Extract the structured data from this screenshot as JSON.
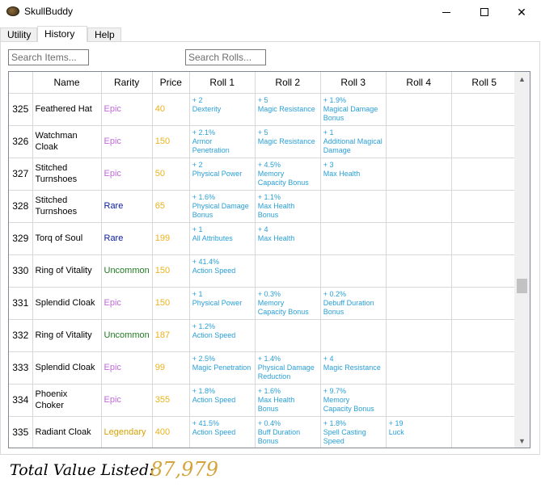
{
  "window": {
    "title": "SkullBuddy",
    "controls": {
      "minimize": "minimize",
      "maximize": "maximize",
      "close": "✕"
    }
  },
  "tabs": [
    {
      "label": "Utility",
      "active": false
    },
    {
      "label": "History",
      "active": true
    },
    {
      "label": "Help",
      "active": false
    }
  ],
  "search": {
    "items_placeholder": "Search Items...",
    "rolls_placeholder": "Search Rolls..."
  },
  "table": {
    "columns": [
      "",
      "Name",
      "Rarity",
      "Price",
      "Roll 1",
      "Roll 2",
      "Roll 3",
      "Roll 4",
      "Roll 5"
    ],
    "rows": [
      {
        "num": "325",
        "name": "Feathered Hat",
        "rarity": "Epic",
        "price": "40",
        "rolls": [
          "+ 2\nDexterity",
          "+ 5\nMagic Resistance",
          "+ 1.9%\nMagical Damage\nBonus",
          "",
          ""
        ]
      },
      {
        "num": "326",
        "name": "Watchman\nCloak",
        "rarity": "Epic",
        "price": "150",
        "rolls": [
          "+ 2.1%\nArmor\nPenetration",
          "+ 5\nMagic Resistance",
          "+ 1\nAdditional Magical\nDamage",
          "",
          ""
        ]
      },
      {
        "num": "327",
        "name": "Stitched\nTurnshoes",
        "rarity": "Epic",
        "price": "50",
        "rolls": [
          "+ 2\nPhysical Power",
          "+ 4.5%\nMemory\nCapacity Bonus",
          "+ 3\nMax Health",
          "",
          ""
        ]
      },
      {
        "num": "328",
        "name": "Stitched\nTurnshoes",
        "rarity": "Rare",
        "price": "65",
        "rolls": [
          "+ 1.6%\nPhysical Damage\nBonus",
          "+ 1.1%\nMax Health\nBonus",
          "",
          "",
          ""
        ]
      },
      {
        "num": "329",
        "name": "Torq of Soul",
        "rarity": "Rare",
        "price": "199",
        "rolls": [
          "+ 1\nAll Attributes",
          "+ 4\nMax Health",
          "",
          "",
          ""
        ]
      },
      {
        "num": "330",
        "name": "Ring of Vitality",
        "rarity": "Uncommon",
        "price": "150",
        "rolls": [
          "+ 41.4%\nAction Speed",
          "",
          "",
          "",
          ""
        ]
      },
      {
        "num": "331",
        "name": "Splendid Cloak",
        "rarity": "Epic",
        "price": "150",
        "rolls": [
          "+ 1\nPhysical Power",
          "+ 0.3%\nMemory\nCapacity Bonus",
          "+ 0.2%\nDebuff Duration\nBonus",
          "",
          ""
        ]
      },
      {
        "num": "332",
        "name": "Ring of Vitality",
        "rarity": "Uncommon",
        "price": "187",
        "rolls": [
          "+ 1.2%\nAction Speed",
          "",
          "",
          "",
          ""
        ]
      },
      {
        "num": "333",
        "name": "Splendid Cloak",
        "rarity": "Epic",
        "price": "99",
        "rolls": [
          "+ 2.5%\nMagic Penetration",
          "+ 1.4%\nPhysical Damage\nReduction",
          "+ 4\nMagic Resistance",
          "",
          ""
        ]
      },
      {
        "num": "334",
        "name": "Phoenix Choker",
        "rarity": "Epic",
        "price": "355",
        "rolls": [
          "+ 1.8%\nAction Speed",
          "+ 1.6%\nMax Health\nBonus",
          "+ 9.7%\nMemory\nCapacity Bonus",
          "",
          ""
        ]
      },
      {
        "num": "335",
        "name": "Radiant Cloak",
        "rarity": "Legendary",
        "price": "400",
        "rolls": [
          "+ 41.5%\nAction Speed",
          "+ 0.4%\nBuff Duration\nBonus",
          "+ 1.8%\nSpell Casting\nSpeed",
          "+ 19\nLuck",
          ""
        ]
      }
    ]
  },
  "rarity_colors": {
    "Epic": "#c06ad8",
    "Rare": "#0a1aa0",
    "Uncommon": "#1f7a1f",
    "Legendary": "#d4a100"
  },
  "colors": {
    "roll_text": "#2a9fd6",
    "price_text": "#e8b21d",
    "total_value": "#d4a43a"
  },
  "footer": {
    "total_label": "Total Value Listed:",
    "total_value": "87,979"
  }
}
